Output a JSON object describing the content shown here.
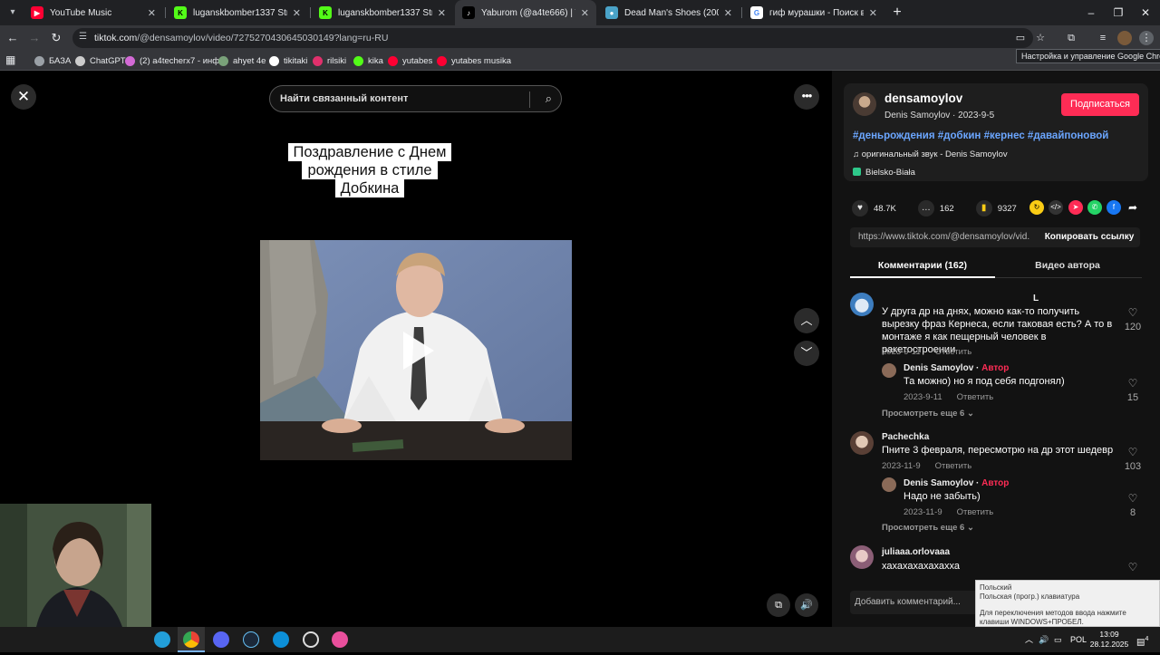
{
  "browser": {
    "tabs": [
      {
        "title": "YouTube Music",
        "favicon": "youtube-music-icon",
        "color": "#ff0033"
      },
      {
        "title": "luganskbomber1337 Stream - K",
        "favicon": "kick-icon",
        "color": "#53fc18"
      },
      {
        "title": "luganskbomber1337 Stream - V",
        "favicon": "kick-icon",
        "color": "#53fc18"
      },
      {
        "title": "Yaburom (@a4te666) | TikTok",
        "favicon": "tiktok-icon",
        "color": "#000000"
      },
      {
        "title": "Dead Man's Shoes (2004) direct",
        "favicon": "movie-icon",
        "color": "#4aa3c8"
      },
      {
        "title": "гиф мурашки - Поиск в Googl",
        "favicon": "google-icon",
        "color": "#ffffff"
      }
    ],
    "url_host": "tiktok.com",
    "url_path": "/@densamoylov/video/7275270430645030149?lang=ru-RU",
    "tooltip": "Настройка и управление Google Chrome",
    "bookmarks": [
      {
        "label": "БАЗА",
        "color": "#9aa0a6"
      },
      {
        "label": "ChatGPT",
        "color": "#cccccc"
      },
      {
        "label": "(2) a4techerx7 - инф...",
        "color": "#d36ad6"
      },
      {
        "label": "ahyet 4e",
        "color": "#7aa27a"
      },
      {
        "label": "tikitaki",
        "color": "#ffffff"
      },
      {
        "label": "rilsiki",
        "color": "#e1306c"
      },
      {
        "label": "kika",
        "color": "#53fc18"
      },
      {
        "label": "yutabes",
        "color": "#ff0033"
      },
      {
        "label": "yutabes musika",
        "color": "#ff0033"
      }
    ]
  },
  "player": {
    "search_placeholder": "Найти связанный контент",
    "caption": "Поздравление с Днем рождения в стиле Добкина"
  },
  "video_info": {
    "author_handle": "densamoylov",
    "author_name": "Denis Samoylov",
    "date": "2023-9-5",
    "follow_label": "Подписаться",
    "hashtags": "#деньрождения #добкин #кернес #давайпоновой",
    "sound": "оригинальный звук - Denis Samoylov",
    "location": "Bielsko-Biała",
    "likes": "48.7K",
    "comments_count": "162",
    "saves": "9327",
    "share_link": "https://www.tiktok.com/@densamoylov/vid...",
    "copy_label": "Копировать ссылку",
    "tab_comments": "Комментарии (162)",
    "tab_author_videos": "Видео автора"
  },
  "comments": [
    {
      "user": "L",
      "text": "У друга др на днях, можно как-то получить вырезку фраз Кернеса, если таковая есть? А то в монтаже я как пещерный человек в ракетостроении",
      "date": "2023-9-11",
      "reply": "Ответить",
      "likes": "120",
      "replies": [
        {
          "user": "Denis Samoylov",
          "tag": "Автор",
          "text": "Та можно) но я под себя подгонял)",
          "date": "2023-9-11",
          "reply": "Ответить",
          "likes": "15"
        }
      ],
      "more": "Просмотреть еще 6"
    },
    {
      "user": "Pachechka",
      "text": "Пните 3 февраля, пересмотрю на др этот шедевр",
      "date": "2023-11-9",
      "reply": "Ответить",
      "likes": "103",
      "replies": [
        {
          "user": "Denis Samoylov",
          "tag": "Автор",
          "text": "Надо не забыть)",
          "date": "2023-11-9",
          "reply": "Ответить",
          "likes": "8"
        }
      ],
      "more": "Просмотреть еще 6"
    },
    {
      "user": "juliaaa.orlovaaa",
      "text": "хахахахахахахха",
      "date": "",
      "reply": "",
      "likes": ""
    }
  ],
  "add_comment_placeholder": "Добавить комментарий...",
  "ime_popup": {
    "line1": "Польский",
    "line2": "Польская (прогр.) клавиатура",
    "line3": "Для переключения методов ввода нажмите клавиши WINDOWS+ПРОБЕЛ."
  },
  "taskbar": {
    "lang": "POL",
    "time": "13:09",
    "date": "28.12.2025",
    "notifications": "4"
  }
}
